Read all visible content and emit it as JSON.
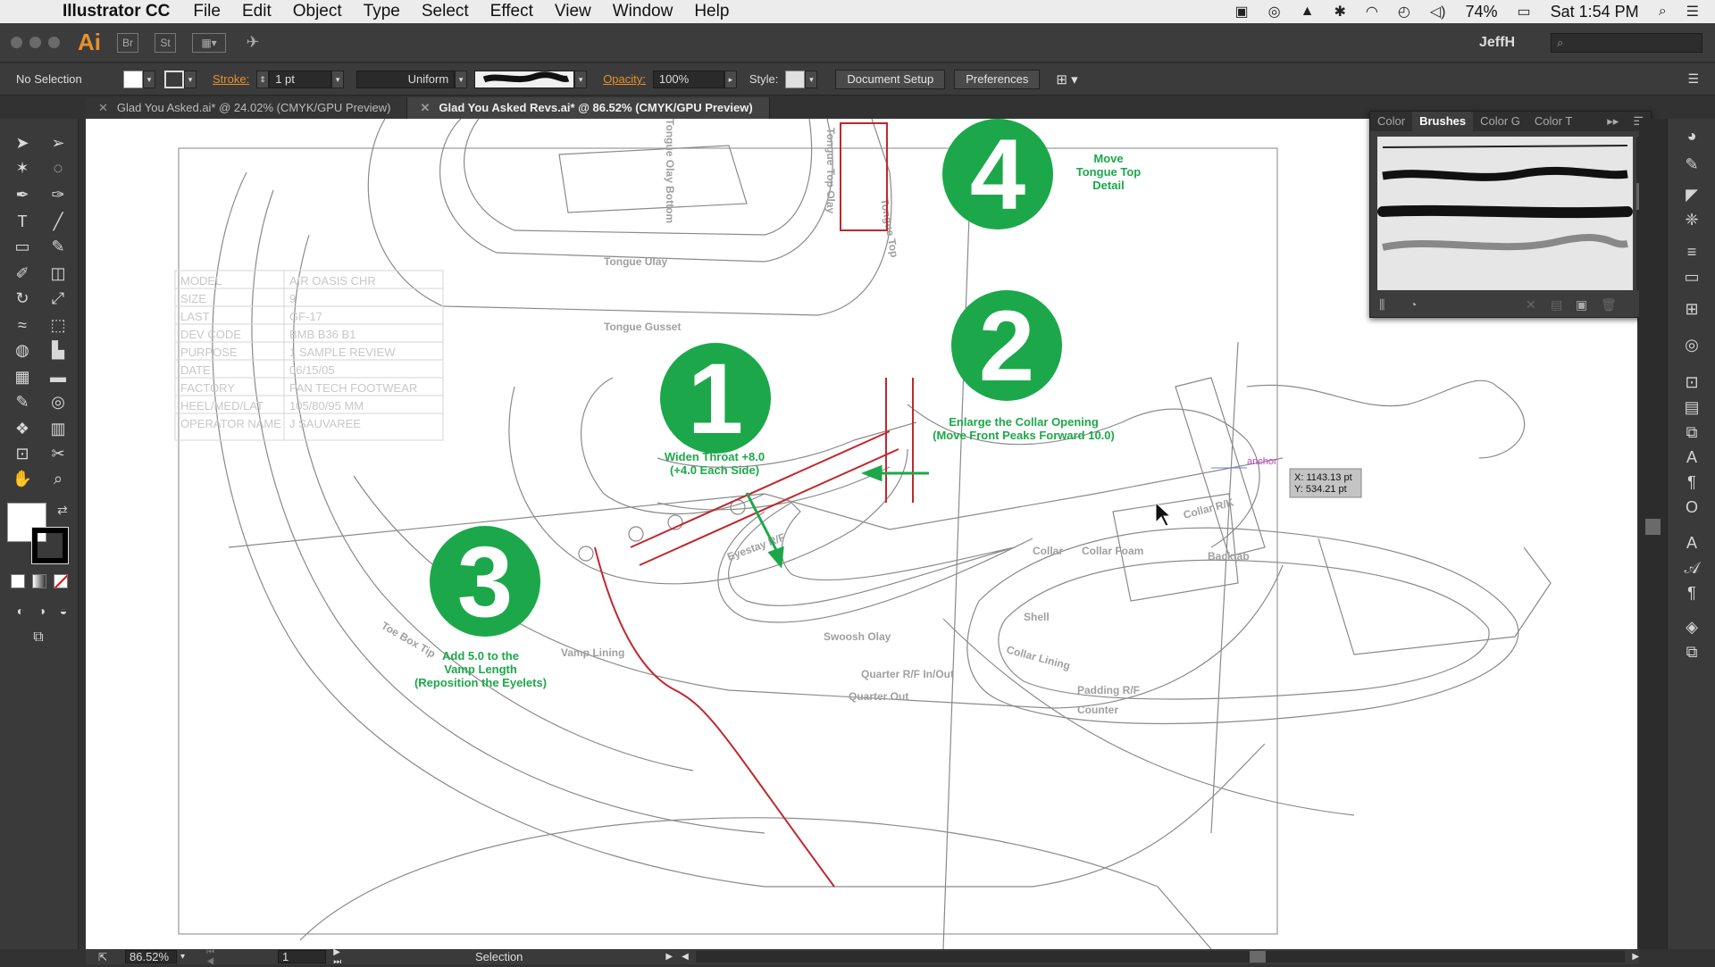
{
  "menubar": {
    "app_name": "Illustrator CC",
    "menus": [
      "File",
      "Edit",
      "Object",
      "Type",
      "Select",
      "Effect",
      "View",
      "Window",
      "Help"
    ],
    "battery": "74%",
    "clock": "Sat 1:54 PM"
  },
  "appbar": {
    "logo": "Ai",
    "bridge": "Br",
    "stock": "St",
    "user": "JeffH"
  },
  "control": {
    "selection": "No Selection",
    "stroke_label": "Stroke:",
    "stroke_value": "1 pt",
    "profile": "Uniform",
    "opacity_label": "Opacity:",
    "opacity_value": "100%",
    "style_label": "Style:",
    "doc_setup": "Document Setup",
    "preferences": "Preferences"
  },
  "tabs": [
    "Glad You Asked.ai* @ 24.02% (CMYK/GPU Preview)",
    "Glad You Asked Revs.ai* @ 86.52% (CMYK/GPU Preview)"
  ],
  "panel": {
    "tabs": [
      "Color",
      "Brushes",
      "Color G",
      "Color T"
    ]
  },
  "artwork": {
    "steps": [
      {
        "num": "1",
        "text_lines": [
          "Widen Throat +8.0",
          "(+4.0 Each Side)"
        ]
      },
      {
        "num": "2",
        "text_lines": [
          "Enlarge the Collar Opening",
          "(Move Front Peaks Forward 10.0)"
        ]
      },
      {
        "num": "3",
        "text_lines": [
          "Add 5.0 to the",
          "Vamp Length",
          "(Reposition the Eyelets)"
        ]
      },
      {
        "num": "4",
        "text_lines": [
          "Move",
          "Tongue Top",
          "Detail"
        ]
      }
    ],
    "part_labels": [
      "Tongue Ulay",
      "Tongue Gusset",
      "Tongue Top Olay",
      "Tongue Top",
      "Tongue Olay Bottom",
      "Eyestay R/F",
      "Swoosh Olay",
      "Vamp Lining",
      "Toe Box Tip",
      "Quarter R/F In/Out",
      "Quarter Out",
      "Shell",
      "Collar",
      "Collar Foam",
      "Collar R/K",
      "Backtab",
      "Collar Lining",
      "Padding R/F",
      "Counter"
    ],
    "spec_table": [
      [
        "MODEL",
        "AIR OASIS CHR"
      ],
      [
        "SIZE",
        "9"
      ],
      [
        "LAST",
        "GF-17"
      ],
      [
        "DEV CODE",
        "BMB B36 B1"
      ],
      [
        "PURPOSE",
        "1 SAMPLE REVIEW"
      ],
      [
        "DATE",
        "06/15/05"
      ],
      [
        "FACTORY",
        "PAN TECH FOOTWEAR"
      ],
      [
        "HEEL/MED/LAT",
        "105/80/95 MM"
      ],
      [
        "OPERATOR NAME",
        "J SAUVAREE"
      ]
    ],
    "anchor_label": "anchor",
    "tooltip_x": "X: 1143.13 pt",
    "tooltip_y": "Y: 534.21 pt",
    "accent_green": "#1ca84a",
    "guide_red": "#c0282d"
  },
  "statusbar": {
    "zoom": "86.52%",
    "page": "1",
    "mode": "Selection"
  }
}
